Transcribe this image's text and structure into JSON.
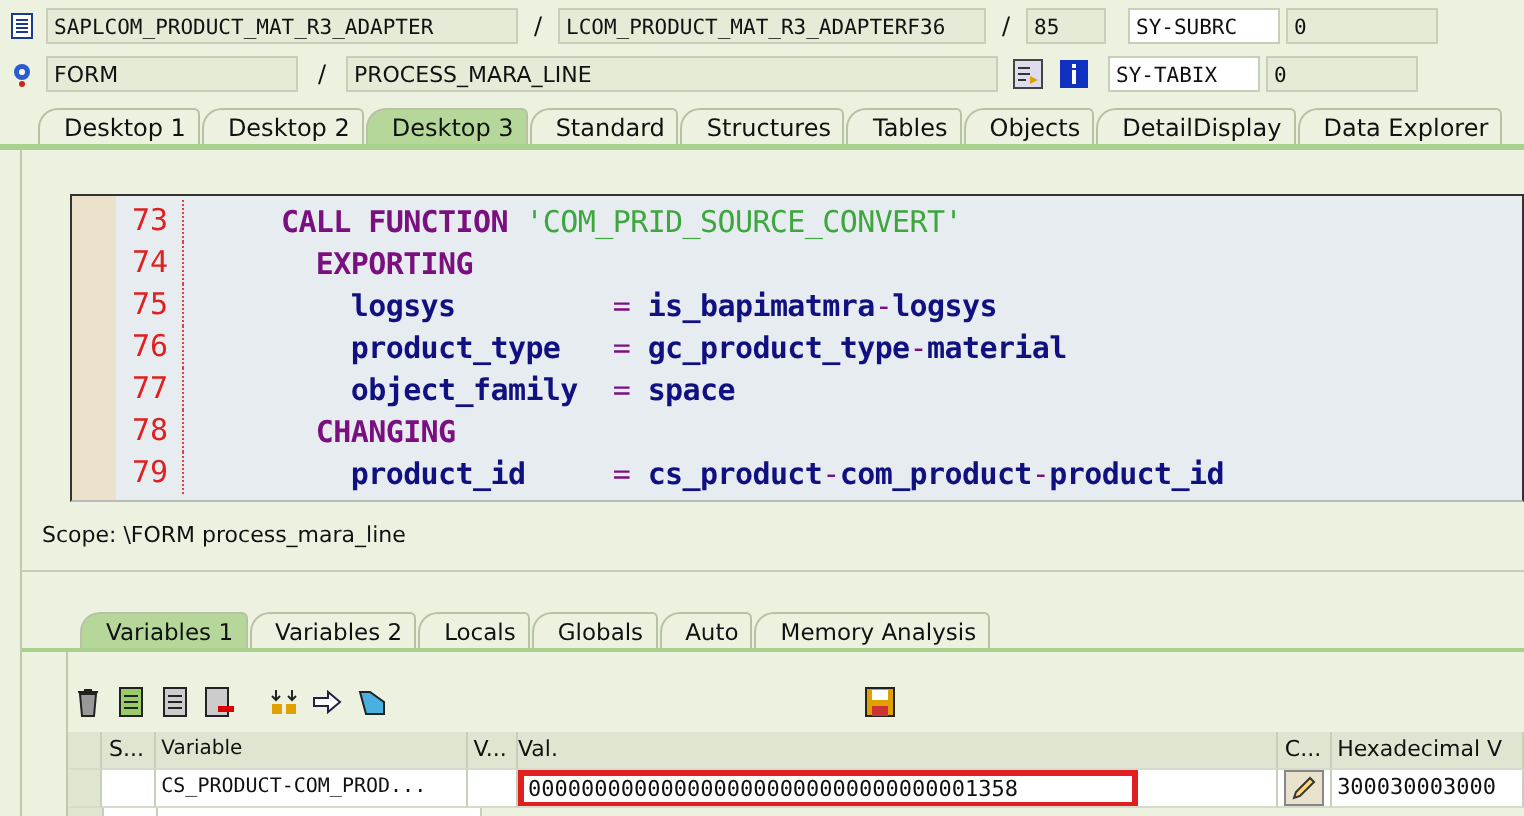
{
  "header": {
    "program": "SAPLCOM_PRODUCT_MAT_R3_ADAPTER",
    "sep1": "/",
    "include": "LCOM_PRODUCT_MAT_R3_ADAPTERF36",
    "sep2": "/",
    "line": "85",
    "field1": "SY-SUBRC",
    "value1": "0",
    "event_type": "FORM",
    "sep3": "/",
    "event": "PROCESS_MARA_LINE",
    "field2": "SY-TABIX",
    "value2": "0"
  },
  "desktop_tabs": [
    {
      "label": "Desktop 1",
      "selected": false
    },
    {
      "label": "Desktop 2",
      "selected": false
    },
    {
      "label": "Desktop 3",
      "selected": true
    },
    {
      "label": "Standard",
      "selected": false
    },
    {
      "label": "Structures",
      "selected": false
    },
    {
      "label": "Tables",
      "selected": false
    },
    {
      "label": "Objects",
      "selected": false
    },
    {
      "label": "DetailDisplay",
      "selected": false
    },
    {
      "label": "Data Explorer",
      "selected": false
    }
  ],
  "code_lines": [
    {
      "number": "73",
      "tokens": [
        {
          "kind": "keyword",
          "text": "  CALL FUNCTION "
        },
        {
          "kind": "string",
          "text": "'COM_PRID_SOURCE_CONVERT'"
        }
      ]
    },
    {
      "number": "74",
      "tokens": [
        {
          "kind": "keyword",
          "text": "    EXPORTING"
        }
      ]
    },
    {
      "number": "75",
      "tokens": [
        {
          "kind": "ident",
          "text": "      logsys"
        },
        {
          "kind": "op",
          "text": "         = "
        },
        {
          "kind": "ident",
          "text": "is_bapimatmra"
        },
        {
          "kind": "op",
          "text": "-"
        },
        {
          "kind": "ident",
          "text": "logsys"
        }
      ]
    },
    {
      "number": "76",
      "tokens": [
        {
          "kind": "ident",
          "text": "      product_type"
        },
        {
          "kind": "op",
          "text": "   = "
        },
        {
          "kind": "ident",
          "text": "gc_product_type"
        },
        {
          "kind": "op",
          "text": "-"
        },
        {
          "kind": "ident",
          "text": "material"
        }
      ]
    },
    {
      "number": "77",
      "tokens": [
        {
          "kind": "ident",
          "text": "      object_family"
        },
        {
          "kind": "op",
          "text": "  = "
        },
        {
          "kind": "ident",
          "text": "space"
        }
      ]
    },
    {
      "number": "78",
      "tokens": [
        {
          "kind": "keyword",
          "text": "    CHANGING"
        }
      ]
    },
    {
      "number": "79",
      "tokens": [
        {
          "kind": "ident",
          "text": "      product_id"
        },
        {
          "kind": "op",
          "text": "     = "
        },
        {
          "kind": "ident",
          "text": "cs_product"
        },
        {
          "kind": "op",
          "text": "-"
        },
        {
          "kind": "ident",
          "text": "com_product"
        },
        {
          "kind": "op",
          "text": "-"
        },
        {
          "kind": "ident",
          "text": "product_id"
        }
      ]
    }
  ],
  "scope": "Scope: \\FORM process_mara_line",
  "variable_tabs": [
    {
      "label": "Variables 1",
      "selected": true
    },
    {
      "label": "Variables 2",
      "selected": false
    },
    {
      "label": "Locals",
      "selected": false
    },
    {
      "label": "Globals",
      "selected": false
    },
    {
      "label": "Auto",
      "selected": false
    },
    {
      "label": "Memory Analysis",
      "selected": false
    }
  ],
  "table": {
    "columns": [
      "S...",
      "Variable",
      "V...",
      "Val.",
      "C...",
      "Hexadecimal V"
    ],
    "rows": [
      {
        "variable": "CS_PRODUCT-COM_PROD...",
        "value": "0000000000000000000000000000000001358",
        "highlighted": true,
        "hex": "300030003000"
      }
    ]
  }
}
